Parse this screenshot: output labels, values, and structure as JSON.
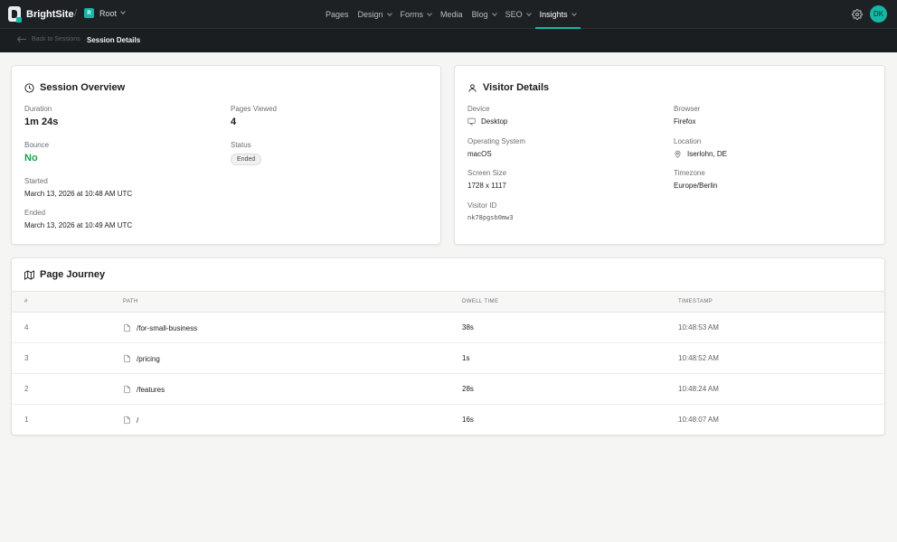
{
  "app": {
    "brand": "BrightSite",
    "root_badge": "R",
    "root_label": "Root",
    "avatar_initials": "DK",
    "accent": "#14b8a6"
  },
  "nav": [
    {
      "label": "Pages",
      "dropdown": false,
      "active": false
    },
    {
      "label": "Design",
      "dropdown": true,
      "active": false
    },
    {
      "label": "Forms",
      "dropdown": true,
      "active": false
    },
    {
      "label": "Media",
      "dropdown": false,
      "active": false
    },
    {
      "label": "Blog",
      "dropdown": true,
      "active": false
    },
    {
      "label": "SEO",
      "dropdown": true,
      "active": false
    },
    {
      "label": "Insights",
      "dropdown": true,
      "active": true
    }
  ],
  "subbar": {
    "back_label": "Back to Sessions",
    "title": "Session Details"
  },
  "session": {
    "title": "Session Overview",
    "duration_label": "Duration",
    "duration": "1m 24s",
    "pages_viewed_label": "Pages Viewed",
    "pages_viewed": "4",
    "bounce_label": "Bounce",
    "bounce": "No",
    "status_label": "Status",
    "status": "Ended",
    "started_label": "Started",
    "started": "March 13, 2026 at 10:48 AM UTC",
    "ended_label": "Ended",
    "ended": "March 13, 2026 at 10:49 AM UTC"
  },
  "visitor": {
    "title": "Visitor Details",
    "device_label": "Device",
    "device": "Desktop",
    "browser_label": "Browser",
    "browser": "Firefox",
    "os_label": "Operating System",
    "os": "macOS",
    "location_label": "Location",
    "location": "Iserlohn, DE",
    "screen_label": "Screen Size",
    "screen": "1728 x 1117",
    "timezone_label": "Timezone",
    "timezone": "Europe/Berlin",
    "visitor_id_label": "Visitor ID",
    "visitor_id": "nk78pgsb0mw3"
  },
  "journey": {
    "title": "Page Journey",
    "columns": {
      "index": "#",
      "path": "Path",
      "dwell": "Dwell Time",
      "timestamp": "Timestamp"
    },
    "rows": [
      {
        "index": "4",
        "path": "/for-small-business",
        "dwell": "38s",
        "timestamp": "10:48:53 AM"
      },
      {
        "index": "3",
        "path": "/pricing",
        "dwell": "1s",
        "timestamp": "10:48:52 AM"
      },
      {
        "index": "2",
        "path": "/features",
        "dwell": "28s",
        "timestamp": "10:48:24 AM"
      },
      {
        "index": "1",
        "path": "/",
        "dwell": "16s",
        "timestamp": "10:48:07 AM"
      }
    ]
  }
}
